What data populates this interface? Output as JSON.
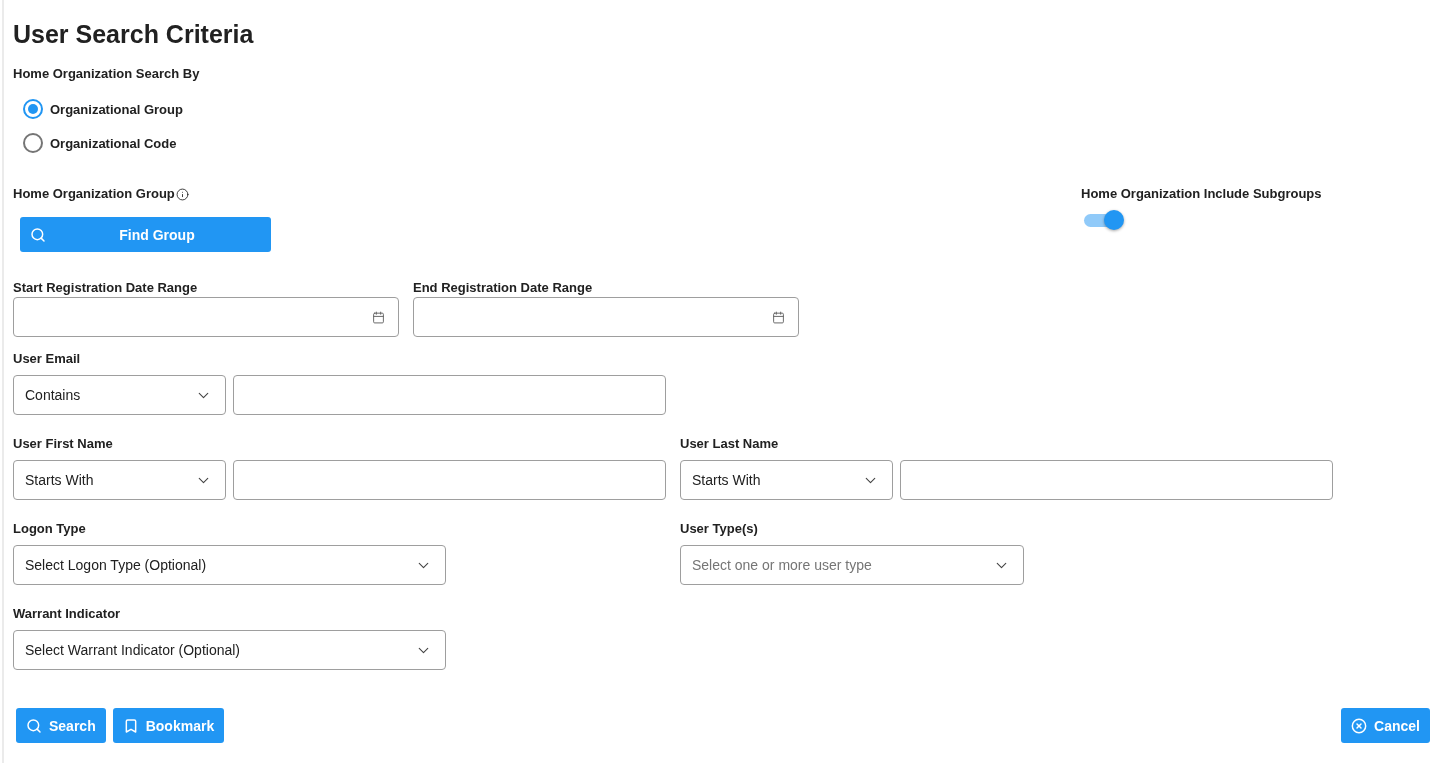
{
  "title": "User Search Criteria",
  "search_by": {
    "label": "Home Organization Search By",
    "options": [
      {
        "label": "Organizational Group",
        "selected": true
      },
      {
        "label": "Organizational Code",
        "selected": false
      }
    ]
  },
  "organization_group": {
    "label": "Home Organization Group",
    "button": "Find Group"
  },
  "include_subgroups": {
    "label": "Home Organization Include Subgroups",
    "on": true
  },
  "rows": [
    [
      {
        "kind": "date",
        "label": "Start Registration Date Range"
      },
      {
        "kind": "date",
        "label": "End Registration Date Range"
      }
    ],
    [
      {
        "kind": "text_filter",
        "label": "User Email",
        "operator": "Contains"
      }
    ],
    [
      {
        "kind": "text_filter",
        "label": "User First Name",
        "operator": "Starts With"
      },
      {
        "kind": "text_filter",
        "label": "User Last Name",
        "operator": "Starts With"
      }
    ],
    [
      {
        "kind": "select",
        "label": "Logon Type",
        "value": "Select Logon Type (Optional)"
      },
      {
        "kind": "select",
        "label": "User Type(s)",
        "placeholder": "Select one or more user type"
      }
    ],
    [
      {
        "kind": "select",
        "label": "Warrant Indicator",
        "value": "Select Warrant Indicator (Optional)"
      }
    ]
  ],
  "actions": {
    "left": [
      {
        "kind": "search",
        "label": "Search"
      },
      {
        "kind": "bookmark",
        "label": "Bookmark"
      }
    ],
    "right": [
      {
        "kind": "cancel",
        "label": "Cancel"
      }
    ]
  }
}
